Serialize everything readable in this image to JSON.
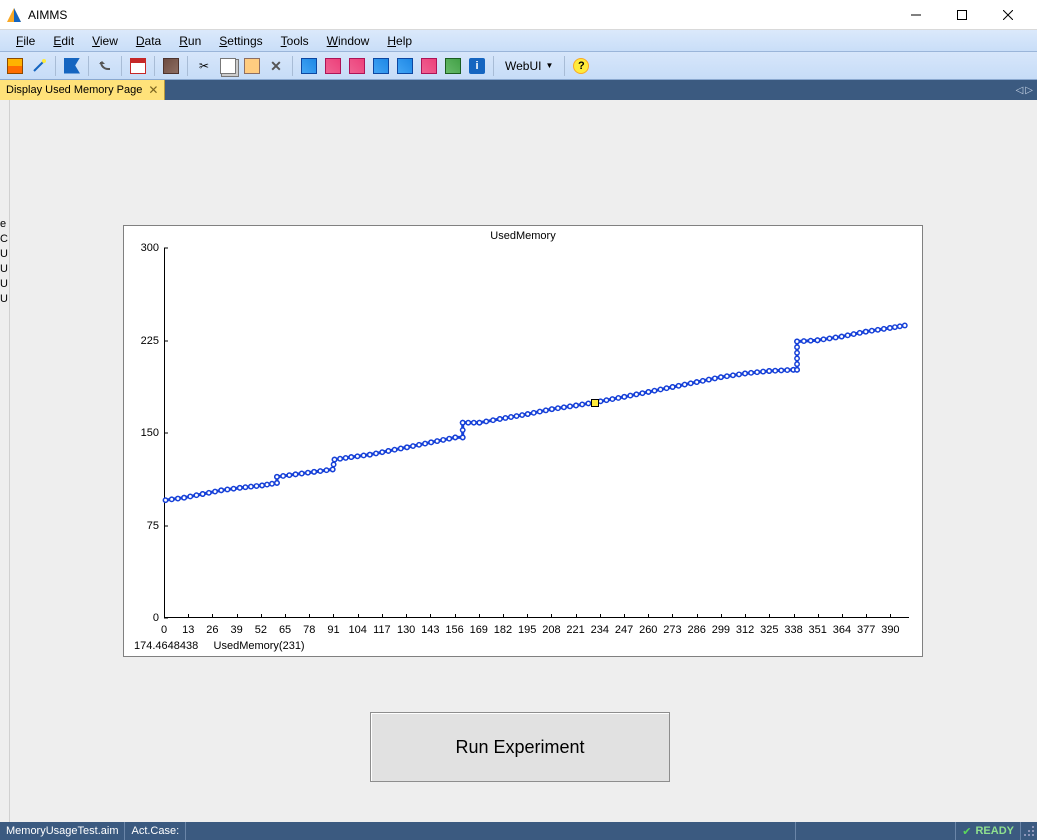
{
  "window": {
    "title": "AIMMS"
  },
  "menu": {
    "items": [
      "File",
      "Edit",
      "View",
      "Data",
      "Run",
      "Settings",
      "Tools",
      "Window",
      "Help"
    ]
  },
  "toolbar": {
    "webui_label": "WebUI"
  },
  "tab": {
    "label": "Display Used Memory Page"
  },
  "left_fragments": [
    "e",
    "C",
    "U",
    "U",
    "U",
    "U"
  ],
  "button": {
    "run_label": "Run Experiment"
  },
  "status": {
    "file": "MemoryUsageTest.aim",
    "case_label": "Act.Case:",
    "ready": "READY"
  },
  "chart_footer": {
    "value": "174.4648438",
    "label": "UsedMemory(231)"
  },
  "chart_data": {
    "type": "line",
    "title": "UsedMemory",
    "xlabel": "",
    "ylabel": "",
    "ylim": [
      0,
      300
    ],
    "xlim": [
      0,
      400
    ],
    "y_ticks": [
      0,
      75,
      150,
      225,
      300
    ],
    "x_ticks": [
      0,
      13,
      26,
      39,
      52,
      65,
      78,
      91,
      104,
      117,
      130,
      143,
      156,
      169,
      182,
      195,
      208,
      221,
      234,
      247,
      260,
      273,
      286,
      299,
      312,
      325,
      338,
      351,
      364,
      377,
      390
    ],
    "highlight": {
      "x": 231,
      "y": 174.4648438
    },
    "series": [
      {
        "name": "UsedMemory",
        "color": "#1640d8",
        "points": [
          [
            0,
            95
          ],
          [
            10,
            97
          ],
          [
            20,
            100
          ],
          [
            30,
            103
          ],
          [
            40,
            105
          ],
          [
            52,
            107
          ],
          [
            60,
            109
          ],
          [
            60,
            114
          ],
          [
            70,
            116
          ],
          [
            80,
            118
          ],
          [
            90,
            120
          ],
          [
            91,
            128
          ],
          [
            100,
            130
          ],
          [
            110,
            132
          ],
          [
            120,
            135
          ],
          [
            130,
            138
          ],
          [
            143,
            142
          ],
          [
            156,
            146
          ],
          [
            160,
            146
          ],
          [
            160,
            158
          ],
          [
            169,
            158
          ],
          [
            180,
            161
          ],
          [
            195,
            165
          ],
          [
            208,
            169
          ],
          [
            221,
            172
          ],
          [
            231,
            174.46
          ],
          [
            247,
            179
          ],
          [
            260,
            183
          ],
          [
            273,
            187
          ],
          [
            286,
            191
          ],
          [
            299,
            195
          ],
          [
            312,
            198
          ],
          [
            325,
            200
          ],
          [
            338,
            201
          ],
          [
            340,
            201
          ],
          [
            340,
            224
          ],
          [
            351,
            225
          ],
          [
            364,
            228
          ],
          [
            377,
            232
          ],
          [
            390,
            235
          ],
          [
            398,
            237
          ]
        ]
      }
    ]
  }
}
